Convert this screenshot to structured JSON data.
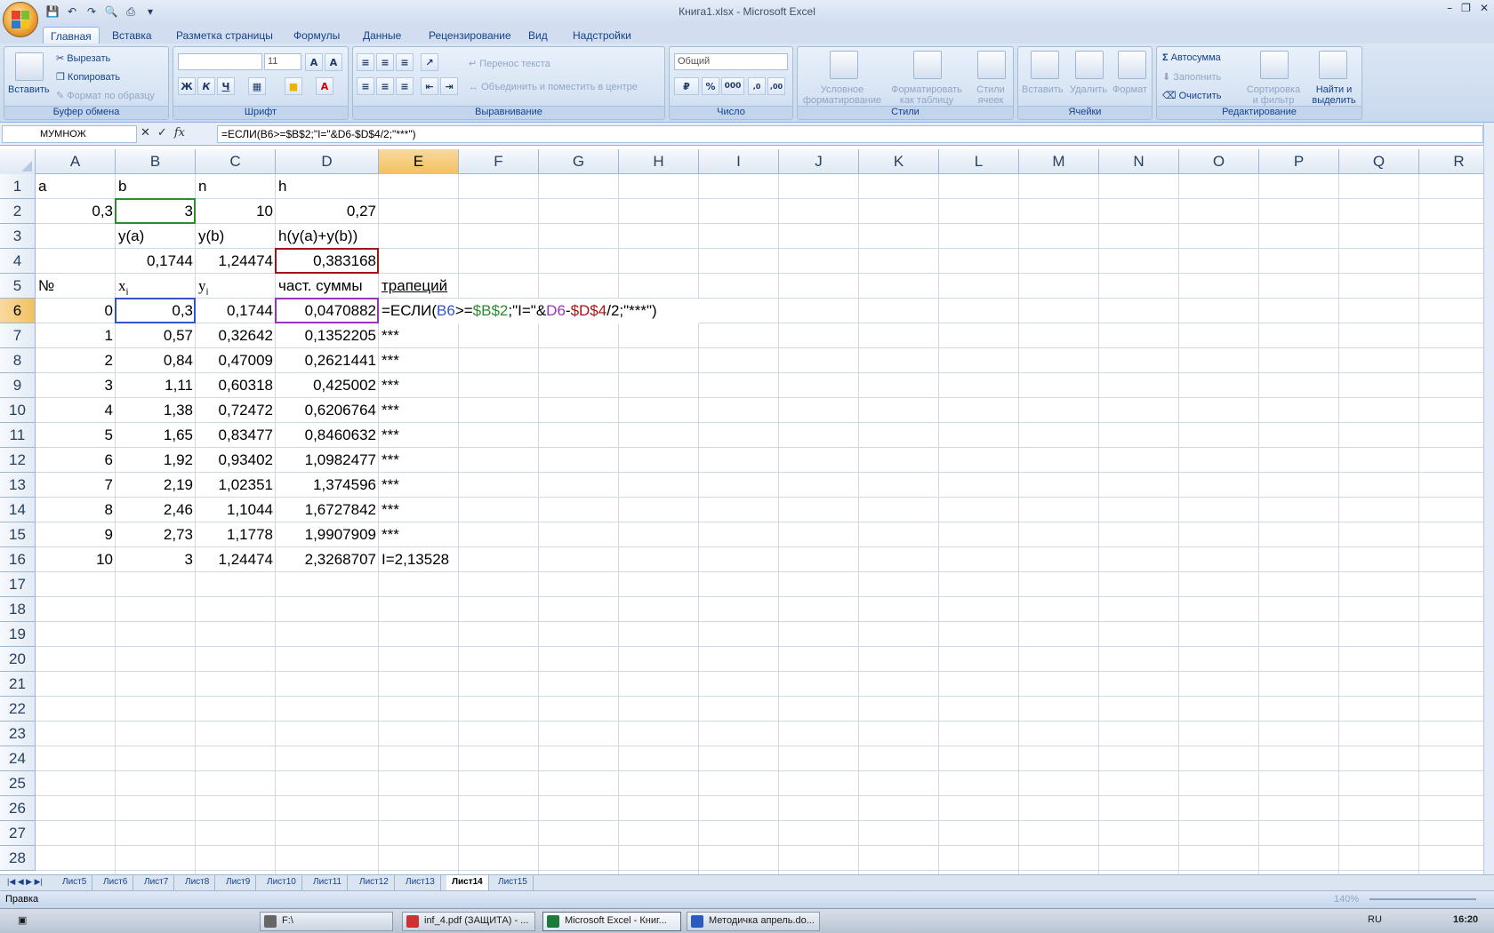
{
  "window": {
    "title": "Книга1.xlsx - Microsoft Excel",
    "controls": [
      "minimize-icon",
      "restore-icon",
      "close-icon"
    ]
  },
  "ribbon": {
    "tabs": [
      "Главная",
      "Вставка",
      "Разметка страницы",
      "Формулы",
      "Данные",
      "Рецензирование",
      "Вид",
      "Надстройки"
    ],
    "active_tab": "Главная",
    "clipboard": {
      "label": "Буфер обмена",
      "paste": "Вставить",
      "cut": "Вырезать",
      "copy": "Копировать",
      "format_painter": "Формат по образцу"
    },
    "font": {
      "label": "Шрифт",
      "size": "11",
      "bold": "Ж",
      "italic": "К",
      "underline": "Ч"
    },
    "alignment": {
      "label": "Выравнивание",
      "wrap": "Перенос текста",
      "merge": "Объединить и поместить в центре"
    },
    "number": {
      "label": "Число",
      "format": "Общий",
      "percent": "%",
      "thousands": "000"
    },
    "styles": {
      "label": "Стили",
      "cond_l1": "Условное",
      "cond_l2": "форматирование",
      "table_l1": "Форматировать",
      "table_l2": "как таблицу",
      "cell_l1": "Стили",
      "cell_l2": "ячеек"
    },
    "cells": {
      "label": "Ячейки",
      "insert": "Вставить",
      "delete": "Удалить",
      "format": "Формат"
    },
    "editing": {
      "label": "Редактирование",
      "autosum": "Автосумма",
      "fill": "Заполнить",
      "clear": "Очистить",
      "sort_l1": "Сортировка",
      "sort_l2": "и фильтр",
      "find_l1": "Найти и",
      "find_l2": "выделить"
    }
  },
  "formula_bar": {
    "name_box": "МУМНОЖ",
    "formula": "=ЕСЛИ(B6>=$B$2;\"I=\"&D6-$D$4/2;\"***\")"
  },
  "columns": [
    "A",
    "B",
    "C",
    "D",
    "E",
    "F",
    "G",
    "H",
    "I",
    "J",
    "K",
    "L",
    "M",
    "N",
    "O",
    "P",
    "Q",
    "R"
  ],
  "rows": [
    "1",
    "2",
    "3",
    "4",
    "5",
    "6",
    "7",
    "8",
    "9",
    "10",
    "11",
    "12",
    "13",
    "14",
    "15",
    "16",
    "17",
    "18",
    "19",
    "20",
    "21",
    "22",
    "23",
    "24",
    "25",
    "26",
    "27",
    "28"
  ],
  "cells": {
    "A1": "a",
    "B1": "b",
    "C1": "n",
    "D1": "h",
    "A2": "0,3",
    "B2": "3",
    "C2": "10",
    "D2": "0,27",
    "B3": "y(a)",
    "C3": "y(b)",
    "D3": "h(y(a)+y(b))",
    "B4": "0,1744",
    "C4": "1,24474",
    "D4": "0,383168",
    "A5": "№",
    "B5_base": "x",
    "B5_sub": "i",
    "C5_base": "y",
    "C5_sub": "i",
    "D5": "част. суммы",
    "E5": "трапеций",
    "edit": {
      "p1": "=ЕСЛИ(",
      "p2": "B6",
      "p3": ">=",
      "p4": "$B$2",
      "p5": ";\"I=\"&",
      "p6": "D6",
      "p7": "-",
      "p8": "$D$4",
      "p9": "/2;\"***\")"
    },
    "colors": {
      "b6": "#3355cc",
      "b2": "#2e8b2e",
      "d6": "#9933bb",
      "d4": "#a31515"
    }
  },
  "table": [
    {
      "n": "0",
      "x": "0,3",
      "y": "0,1744",
      "s": "0,0470882",
      "e": ""
    },
    {
      "n": "1",
      "x": "0,57",
      "y": "0,32642",
      "s": "0,1352205",
      "e": "***"
    },
    {
      "n": "2",
      "x": "0,84",
      "y": "0,47009",
      "s": "0,2621441",
      "e": "***"
    },
    {
      "n": "3",
      "x": "1,11",
      "y": "0,60318",
      "s": "0,425002",
      "e": "***"
    },
    {
      "n": "4",
      "x": "1,38",
      "y": "0,72472",
      "s": "0,6206764",
      "e": "***"
    },
    {
      "n": "5",
      "x": "1,65",
      "y": "0,83477",
      "s": "0,8460632",
      "e": "***"
    },
    {
      "n": "6",
      "x": "1,92",
      "y": "0,93402",
      "s": "1,0982477",
      "e": "***"
    },
    {
      "n": "7",
      "x": "2,19",
      "y": "1,02351",
      "s": "1,374596",
      "e": "***"
    },
    {
      "n": "8",
      "x": "2,46",
      "y": "1,1044",
      "s": "1,6727842",
      "e": "***"
    },
    {
      "n": "9",
      "x": "2,73",
      "y": "1,1778",
      "s": "1,9907909",
      "e": "***"
    },
    {
      "n": "10",
      "x": "3",
      "y": "1,24474",
      "s": "2,3268707",
      "e": "I=2,13528"
    }
  ],
  "sheets": [
    "Лист5",
    "Лист6",
    "Лист7",
    "Лист8",
    "Лист9",
    "Лист10",
    "Лист11",
    "Лист12",
    "Лист13",
    "Лист14",
    "Лист15"
  ],
  "active_sheet": "Лист14",
  "status": {
    "mode": "Правка",
    "zoom": "140%"
  },
  "taskbar": {
    "tasks": [
      "F:\\",
      "inf_4.pdf (ЗАЩИТА) - ...",
      "Microsoft Excel - Книг...",
      "Методичка апрель.do..."
    ],
    "lang": "RU",
    "clock": "16:20"
  }
}
